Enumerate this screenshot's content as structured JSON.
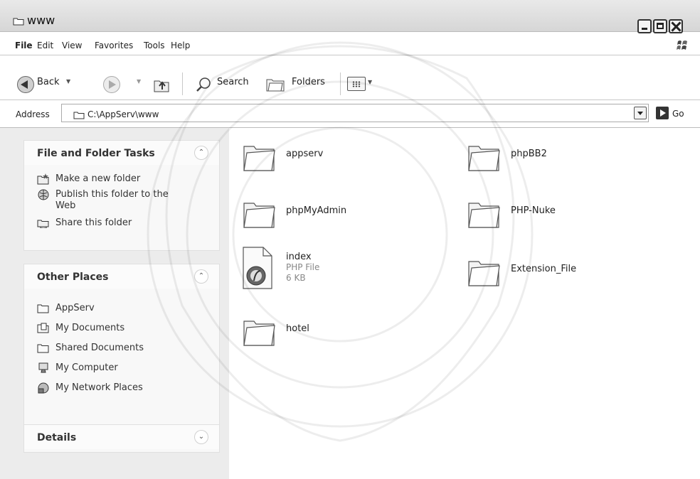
{
  "window": {
    "title": "www"
  },
  "menu": [
    "File",
    "Edit",
    "View",
    "Favorites",
    "Tools",
    "Help"
  ],
  "toolbar": {
    "back_label": "Back",
    "search_label": "Search",
    "folders_label": "Folders"
  },
  "address": {
    "label": "Address",
    "value": "C:\\AppServ\\www",
    "go_label": "Go"
  },
  "tasks_panel": {
    "title": "File and Folder Tasks",
    "items": [
      {
        "label": "Make a new folder",
        "icon": "new-folder-icon"
      },
      {
        "label": "Publish this folder to the",
        "label2": "Web",
        "icon": "globe-icon"
      },
      {
        "label": "Share this folder",
        "icon": "share-folder-icon"
      }
    ]
  },
  "places_panel": {
    "title": "Other Places",
    "items": [
      {
        "label": "AppServ",
        "icon": "folder-icon"
      },
      {
        "label": "My Documents",
        "icon": "my-documents-icon"
      },
      {
        "label": "Shared Documents",
        "icon": "folder-icon"
      },
      {
        "label": "My Computer",
        "icon": "computer-icon"
      },
      {
        "label": "My Network Places",
        "icon": "network-icon"
      }
    ]
  },
  "details_panel": {
    "title": "Details"
  },
  "files": [
    {
      "name": "appserv",
      "type": "folder"
    },
    {
      "name": "phpBB2",
      "type": "folder"
    },
    {
      "name": "phpMyAdmin",
      "type": "folder"
    },
    {
      "name": "PHP-Nuke",
      "type": "folder"
    },
    {
      "name": "index",
      "type": "PHP File",
      "size": "6 KB"
    },
    {
      "name": "Extension_File",
      "type": "folder"
    },
    {
      "name": "hotel",
      "type": "folder"
    }
  ]
}
